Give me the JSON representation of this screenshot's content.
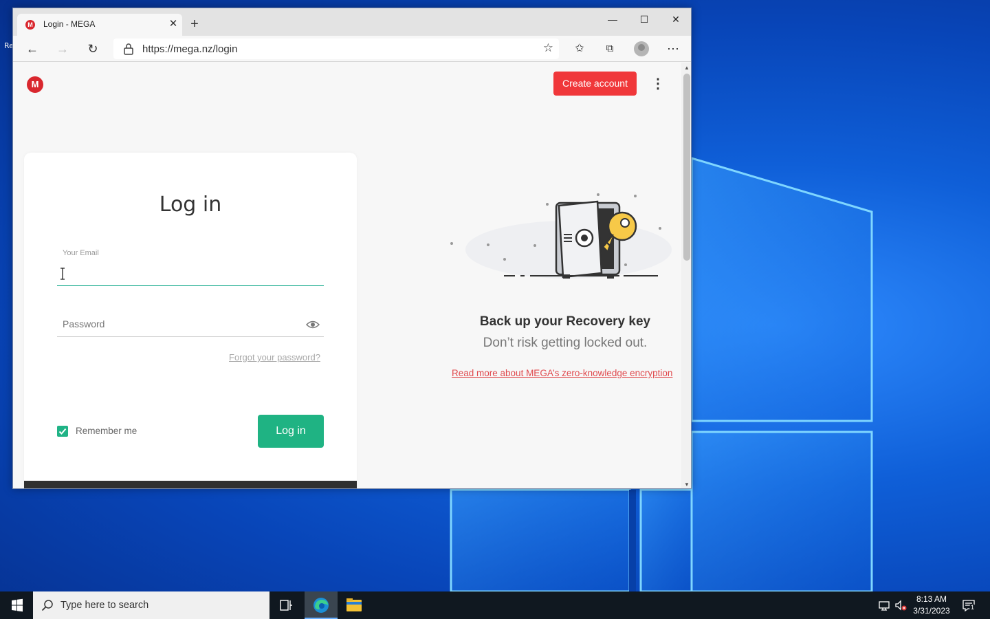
{
  "desktop": {
    "left_text": "Re"
  },
  "browser": {
    "tab": {
      "title": "Login - MEGA",
      "favicon": "M"
    },
    "address": {
      "url": "https://mega.nz/login"
    },
    "window_controls": {
      "minimize": "—",
      "maximize": "☐",
      "close": "✕"
    }
  },
  "page": {
    "logo": "M",
    "create_account": "Create account",
    "login": {
      "title": "Log in",
      "email_label": "Your Email",
      "password_placeholder": "Password",
      "forgot": "Forgot your password?",
      "remember": "Remember me",
      "remember_checked": true,
      "submit": "Log in"
    },
    "promo": {
      "title": "Back up your Recovery key",
      "subtitle": "Don’t risk getting locked out.",
      "link": "Read more about MEGA’s zero-knowledge encryption"
    }
  },
  "taskbar": {
    "search_placeholder": "Type here to search",
    "time": "8:13 AM",
    "date": "3/31/2023",
    "notification_count": "1"
  },
  "colors": {
    "brand_red": "#d9272e",
    "create_button": "#f0373a",
    "login_button": "#1fb383",
    "link_red": "#e0484c"
  }
}
